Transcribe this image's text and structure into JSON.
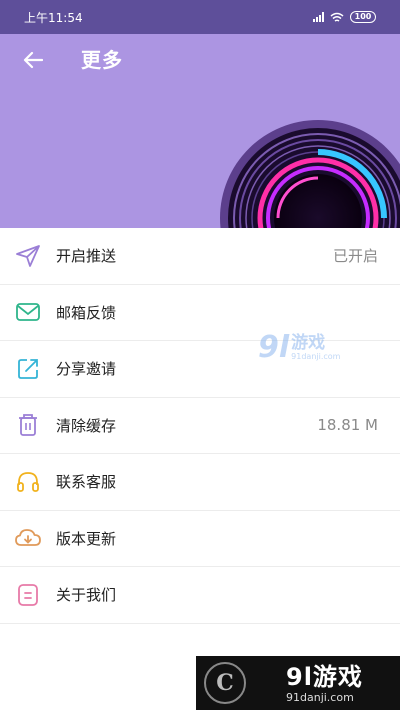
{
  "status_bar": {
    "time": "上午11:54",
    "battery": "100",
    "signal_icon": "signal-icon",
    "wifi_icon": "wifi-icon"
  },
  "header": {
    "title": "更多",
    "back_icon": "arrow-left-icon",
    "background_color": "#ac95e2"
  },
  "menu": {
    "items": [
      {
        "label": "开启推送",
        "value": "已开启",
        "icon": "paper-plane-icon",
        "icon_color": "#9b7fd6"
      },
      {
        "label": "邮箱反馈",
        "value": "",
        "icon": "mail-icon",
        "icon_color": "#2fb58b"
      },
      {
        "label": "分享邀请",
        "value": "",
        "icon": "share-icon",
        "icon_color": "#35b4d6"
      },
      {
        "label": "清除缓存",
        "value": "18.81 M",
        "icon": "trash-icon",
        "icon_color": "#9b7fd6"
      },
      {
        "label": "联系客服",
        "value": "",
        "icon": "headphones-icon",
        "icon_color": "#f1b21d"
      },
      {
        "label": "版本更新",
        "value": "",
        "icon": "cloud-download-icon",
        "icon_color": "#e09a5a"
      },
      {
        "label": "关于我们",
        "value": "",
        "icon": "info-card-icon",
        "icon_color": "#e77aa8"
      }
    ]
  },
  "watermarks": {
    "middle": {
      "number": "9l",
      "text": "游戏",
      "url": "91danji.com"
    },
    "bottom": {
      "logo": "C",
      "brand": "9l游戏",
      "url": "91danji.com"
    }
  }
}
